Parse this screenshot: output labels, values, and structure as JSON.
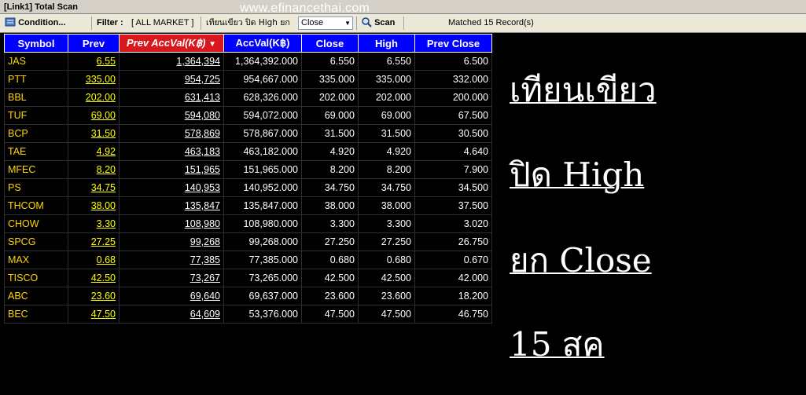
{
  "window_title": "[Link1] Total Scan",
  "watermark": "www.efinancethai.com",
  "toolbar": {
    "condition_label": "Condition...",
    "filter_label": "Filter :",
    "filter_value": "[ ALL MARKET ]",
    "criteria_text": "เทียนเขียว  ปิด  High ยก",
    "select_value": "Close",
    "scan_label": "Scan",
    "matched_text": "Matched 15 Record(s)"
  },
  "table": {
    "columns": [
      "Symbol",
      "Prev",
      "Prev AccVal(K฿)",
      "AccVal(K฿)",
      "Close",
      "High",
      "Prev Close"
    ],
    "sorted_column": "Prev AccVal(K฿)",
    "rows": [
      {
        "symbol": "JAS",
        "prev": "6.55",
        "prev_accval": "1,364,394",
        "accval": "1,364,392.000",
        "close": "6.550",
        "high": "6.550",
        "prev_close": "6.500"
      },
      {
        "symbol": "PTT",
        "prev": "335.00",
        "prev_accval": "954,725",
        "accval": "954,667.000",
        "close": "335.000",
        "high": "335.000",
        "prev_close": "332.000"
      },
      {
        "symbol": "BBL",
        "prev": "202.00",
        "prev_accval": "631,413",
        "accval": "628,326.000",
        "close": "202.000",
        "high": "202.000",
        "prev_close": "200.000"
      },
      {
        "symbol": "TUF",
        "prev": "69.00",
        "prev_accval": "594,080",
        "accval": "594,072.000",
        "close": "69.000",
        "high": "69.000",
        "prev_close": "67.500"
      },
      {
        "symbol": "BCP",
        "prev": "31.50",
        "prev_accval": "578,869",
        "accval": "578,867.000",
        "close": "31.500",
        "high": "31.500",
        "prev_close": "30.500"
      },
      {
        "symbol": "TAE",
        "prev": "4.92",
        "prev_accval": "463,183",
        "accval": "463,182.000",
        "close": "4.920",
        "high": "4.920",
        "prev_close": "4.640"
      },
      {
        "symbol": "MFEC",
        "prev": "8.20",
        "prev_accval": "151,965",
        "accval": "151,965.000",
        "close": "8.200",
        "high": "8.200",
        "prev_close": "7.900"
      },
      {
        "symbol": "PS",
        "prev": "34.75",
        "prev_accval": "140,953",
        "accval": "140,952.000",
        "close": "34.750",
        "high": "34.750",
        "prev_close": "34.500"
      },
      {
        "symbol": "THCOM",
        "prev": "38.00",
        "prev_accval": "135,847",
        "accval": "135,847.000",
        "close": "38.000",
        "high": "38.000",
        "prev_close": "37.500"
      },
      {
        "symbol": "CHOW",
        "prev": "3.30",
        "prev_accval": "108,980",
        "accval": "108,980.000",
        "close": "3.300",
        "high": "3.300",
        "prev_close": "3.020"
      },
      {
        "symbol": "SPCG",
        "prev": "27.25",
        "prev_accval": "99,268",
        "accval": "99,268.000",
        "close": "27.250",
        "high": "27.250",
        "prev_close": "26.750"
      },
      {
        "symbol": "MAX",
        "prev": "0.68",
        "prev_accval": "77,385",
        "accval": "77,385.000",
        "close": "0.680",
        "high": "0.680",
        "prev_close": "0.670"
      },
      {
        "symbol": "TISCO",
        "prev": "42.50",
        "prev_accval": "73,267",
        "accval": "73,265.000",
        "close": "42.500",
        "high": "42.500",
        "prev_close": "42.000"
      },
      {
        "symbol": "ABC",
        "prev": "23.60",
        "prev_accval": "69,640",
        "accval": "69,637.000",
        "close": "23.600",
        "high": "23.600",
        "prev_close": "18.200"
      },
      {
        "symbol": "BEC",
        "prev": "47.50",
        "prev_accval": "64,609",
        "accval": "53,376.000",
        "close": "47.500",
        "high": "47.500",
        "prev_close": "46.750"
      }
    ]
  },
  "overlay": {
    "line1": "เทียนเขียว",
    "line2": "ปิด High",
    "line3": "ยก Close",
    "line4": "15 สค"
  },
  "colors": {
    "background": "#000000",
    "header_bg": "#0000ff",
    "sorted_header_bg": "#d9181e",
    "symbol_text": "#ffd700",
    "prev_text": "#ffff00",
    "value_text": "#ffffff"
  },
  "icons": [
    "condition-icon",
    "scan-icon",
    "sort-desc-icon",
    "dropdown-arrow-icon"
  ]
}
